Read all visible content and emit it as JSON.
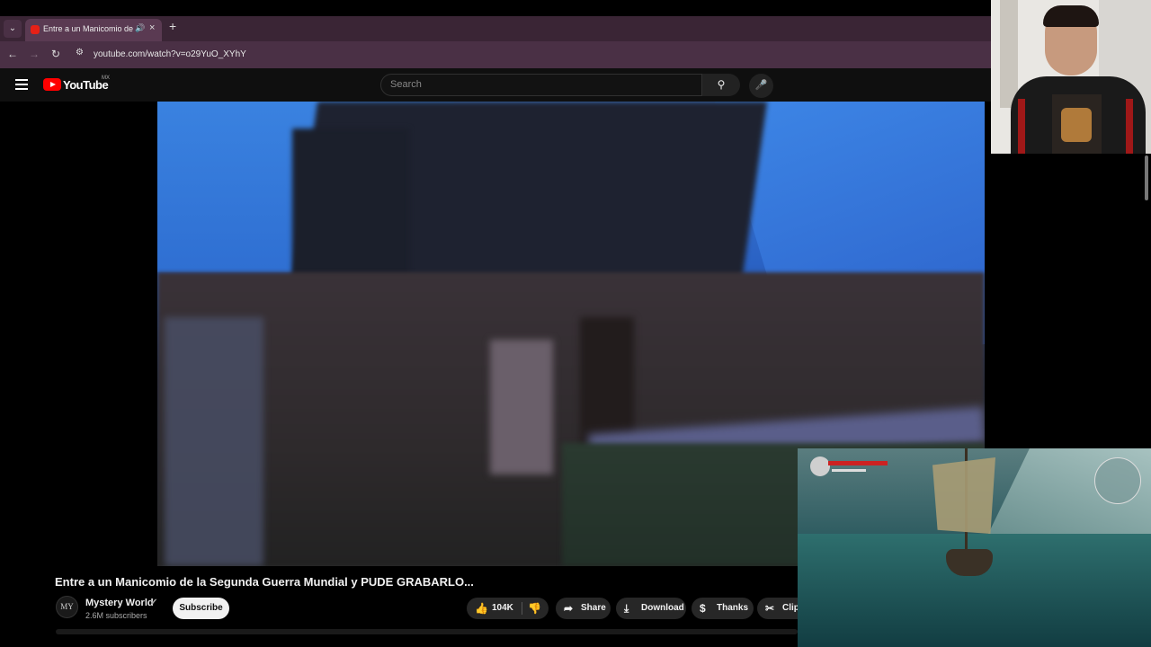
{
  "browser": {
    "tab_title": "Entre a un Manicomio de la",
    "tab_close": "×",
    "new_tab": "+",
    "url": "youtube.com/watch?v=o29YuO_XYhY"
  },
  "youtube": {
    "logo_text": "YouTube",
    "country": "MX",
    "search_placeholder": "Search"
  },
  "video": {
    "title": "Entre a un Manicomio de la Segunda Guerra Mundial y PUDE GRABARLO..."
  },
  "channel": {
    "name": "Mystery World",
    "subscribers": "2.6M subscribers",
    "avatar_text": "MY",
    "subscribe_label": "Subscribe"
  },
  "actions": {
    "likes": "104K",
    "share": "Share",
    "download": "Download",
    "thanks": "Thanks",
    "clip": "Clip"
  },
  "icons": {
    "hamburger": "menu-icon",
    "search": "search-icon",
    "mic": "mic-icon",
    "like": "thumbs-up-icon",
    "dislike": "thumbs-down-icon",
    "share": "share-arrow-icon",
    "download": "download-icon",
    "thanks": "thanks-icon",
    "clip": "scissors-icon"
  },
  "colors": {
    "accent": "#ff0000",
    "background": "#0f0f0f",
    "tab_bar": "#3a2535"
  }
}
